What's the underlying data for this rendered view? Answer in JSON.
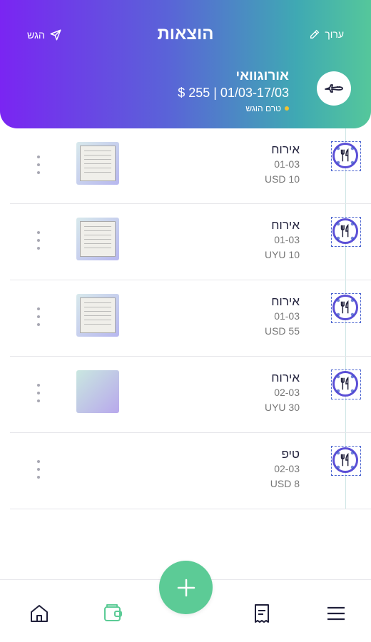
{
  "header": {
    "title": "הוצאות",
    "send_label": "הגש",
    "edit_label": "ערוך"
  },
  "trip": {
    "name": "אורוגוואי",
    "summary": "$ 255 | 01/03-17/03",
    "status": "טרם הוגש",
    "icon": "airplane-icon"
  },
  "expenses": [
    {
      "title": "אירוח",
      "date": "01-03",
      "amount": "USD 10",
      "icon": "food-icon",
      "has_receipt": true
    },
    {
      "title": "אירוח",
      "date": "01-03",
      "amount": "UYU 10",
      "icon": "food-icon",
      "has_receipt": true
    },
    {
      "title": "אירוח",
      "date": "01-03",
      "amount": "USD 55",
      "icon": "food-icon",
      "has_receipt": true
    },
    {
      "title": "אירוח",
      "date": "02-03",
      "amount": "UYU 30",
      "icon": "food-icon",
      "has_receipt": false
    },
    {
      "title": "טיפ",
      "date": "02-03",
      "amount": "USD 8",
      "icon": "food-icon",
      "has_receipt": null
    }
  ],
  "bottom_nav": [
    {
      "name": "home-icon"
    },
    {
      "name": "wallet-icon",
      "active": true
    },
    {
      "name": "receipt-icon"
    },
    {
      "name": "menu-icon"
    }
  ],
  "colors": {
    "gradient_start": "#7a25f2",
    "gradient_end": "#55c79b",
    "accent_green": "#5ccb96",
    "category_ring": "#5b4fd6"
  }
}
